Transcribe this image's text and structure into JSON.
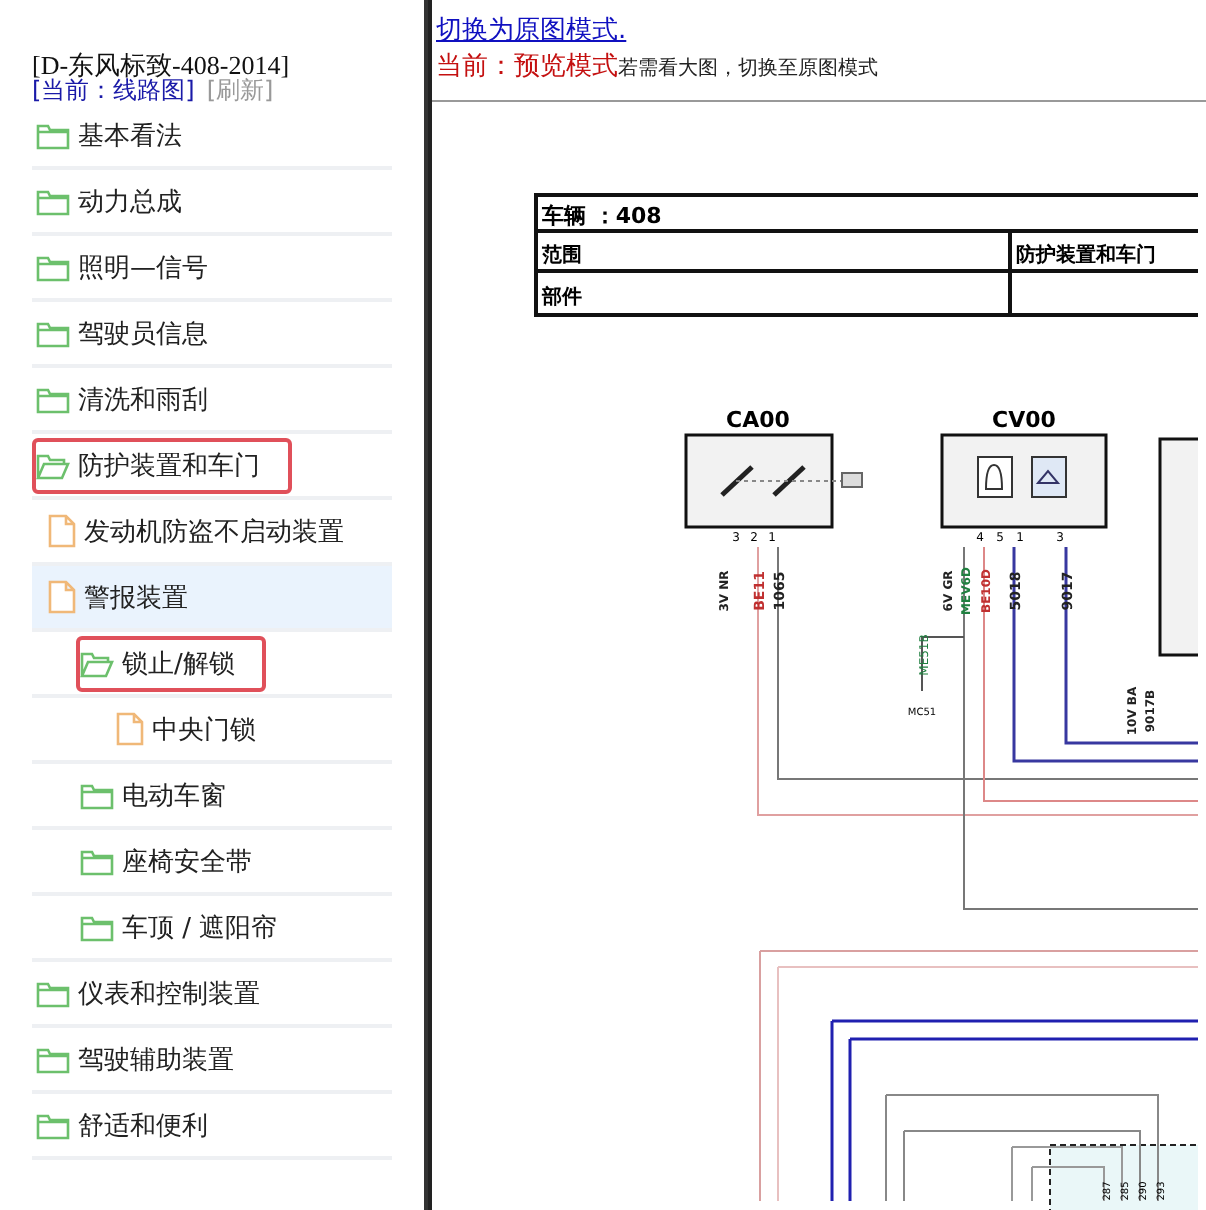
{
  "sidebar": {
    "title": "[D-东风标致-408-2014]",
    "current": "[当前：线路图]",
    "refresh": "[刷新]",
    "tree": [
      {
        "label": "基本看法",
        "kind": "folder",
        "expanded": false,
        "selected": false,
        "marked": false
      },
      {
        "label": "动力总成",
        "kind": "folder",
        "expanded": false,
        "selected": false,
        "marked": false
      },
      {
        "label": "照明—信号",
        "kind": "folder",
        "expanded": false,
        "selected": false,
        "marked": false
      },
      {
        "label": "驾驶员信息",
        "kind": "folder",
        "expanded": false,
        "selected": false,
        "marked": false
      },
      {
        "label": "清洗和雨刮",
        "kind": "folder",
        "expanded": false,
        "selected": false,
        "marked": false
      },
      {
        "label": "防护装置和车门",
        "kind": "folder",
        "expanded": true,
        "selected": false,
        "marked": true,
        "children": [
          {
            "label": "发动机防盗不启动装置",
            "kind": "file",
            "expanded": false,
            "selected": false,
            "marked": false
          },
          {
            "label": "警报装置",
            "kind": "file",
            "expanded": true,
            "selected": true,
            "marked": false,
            "children": [
              {
                "label": "锁止/解锁",
                "kind": "folder",
                "expanded": true,
                "selected": false,
                "marked": true,
                "children": [
                  {
                    "label": "中央门锁",
                    "kind": "file",
                    "expanded": false,
                    "selected": false,
                    "marked": false
                  }
                ]
              },
              {
                "label": "电动车窗",
                "kind": "folder",
                "expanded": false,
                "selected": false,
                "marked": false
              },
              {
                "label": "座椅安全带",
                "kind": "folder",
                "expanded": false,
                "selected": false,
                "marked": false
              },
              {
                "label": "车顶 / 遮阳帘",
                "kind": "folder",
                "expanded": false,
                "selected": false,
                "marked": false
              }
            ]
          }
        ]
      },
      {
        "label": "仪表和控制装置",
        "kind": "folder",
        "expanded": false,
        "selected": false,
        "marked": false
      },
      {
        "label": "驾驶辅助装置",
        "kind": "folder",
        "expanded": false,
        "selected": false,
        "marked": false
      },
      {
        "label": "舒适和便利",
        "kind": "folder",
        "expanded": false,
        "selected": false,
        "marked": false
      }
    ]
  },
  "main": {
    "switch_link": "切换为原图模式.",
    "mode": "当前：预览模式",
    "hint": "若需看大图，切换至原图模式",
    "diagram": {
      "vehicle": "车辆 ：408",
      "scope_label": "范围",
      "scope_value": "防护装置和车门",
      "part_label": "部件",
      "components": [
        {
          "name": "CA00",
          "pins": [
            "3",
            "2",
            "1"
          ]
        },
        {
          "name": "CV00",
          "pins": [
            "4",
            "5",
            "1",
            "3"
          ]
        }
      ],
      "wire_labels": [
        "3V NR",
        "BE11",
        "1065",
        "6V GR",
        "MEV6D",
        "BE10D",
        "5018",
        "9017",
        "ME51B",
        "10V BA",
        "9017B"
      ],
      "ground": "MC51",
      "bottom_labels": [
        "287",
        "285",
        "290",
        "293"
      ]
    }
  }
}
